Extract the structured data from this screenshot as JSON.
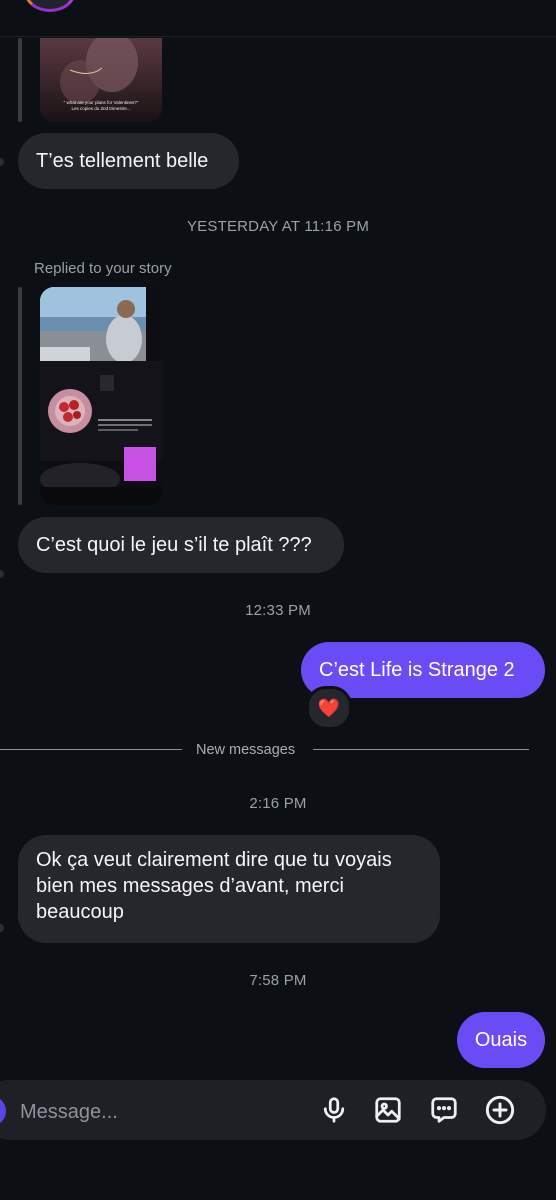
{
  "thread": {
    "msg1": "T’es tellement belle",
    "ts1": "YESTERDAY AT 11:16 PM",
    "replied_label": "Replied to your story",
    "story1_caption_1": "\" what are your plans for Valentines?\"",
    "story1_caption_2": "Les copies du 2nd trimestre...",
    "msg2": "C’est quoi le jeu s’il te plaît ???",
    "ts2": "12:33 PM",
    "msg3": "C’est Life is Strange 2",
    "reaction": "❤️",
    "new_messages": "New messages",
    "ts3": "2:16 PM",
    "msg4": "Ok ça veut clairement dire que tu voyais bien mes messages d’avant, merci beaucoup",
    "ts4": "7:58 PM",
    "msg5": "Ouais"
  },
  "composer": {
    "placeholder": "Message...",
    "icons": [
      "microphone-icon",
      "gallery-icon",
      "sticker-icon",
      "add-icon"
    ]
  },
  "colors": {
    "background": "#0c0f14",
    "incoming_bubble": "#25272d",
    "outgoing_bubble": "#6a4cf6",
    "timestamp": "#9aa0aa"
  }
}
